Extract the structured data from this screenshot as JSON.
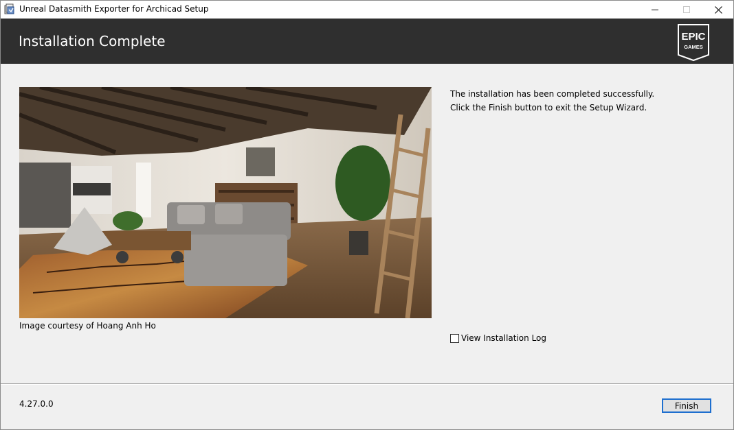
{
  "window": {
    "title": "Unreal Datasmith Exporter for Archicad Setup",
    "icons": {
      "app": "setup-app-icon",
      "minimize": "minimize-icon",
      "maximize": "maximize-icon",
      "close": "close-icon"
    }
  },
  "header": {
    "title": "Installation Complete",
    "logo": {
      "line1": "EPIC",
      "line2": "GAMES",
      "icon": "epic-games-logo"
    }
  },
  "main": {
    "image_caption": "Image courtesy of Hoang Anh Ho",
    "message_line1": "The installation has been completed successfully.",
    "message_line2": "Click the Finish button to exit the Setup Wizard.",
    "view_log_label": "View Installation Log",
    "view_log_checked": false
  },
  "footer": {
    "version": "4.27.0.0",
    "finish_label": "Finish"
  },
  "colors": {
    "header_bg": "#2f2f2f",
    "window_bg": "#f0f0f0",
    "button_focus": "#1e6fcf"
  }
}
